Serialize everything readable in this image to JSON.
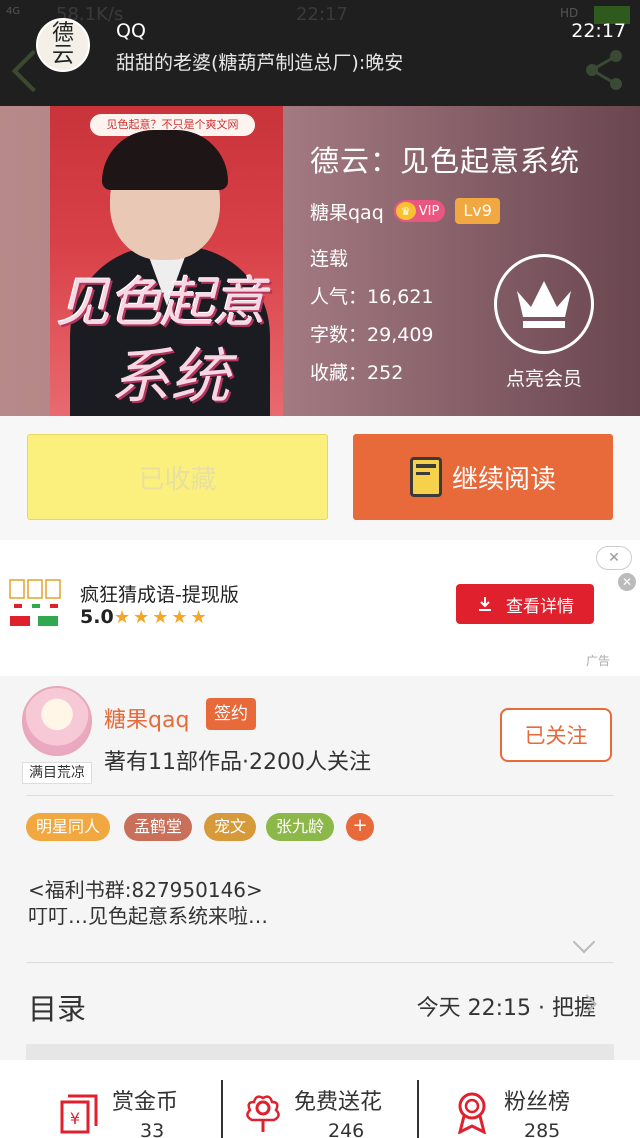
{
  "status_bar": {
    "network": "4G",
    "speed": "58.1K/s",
    "time": "22:17",
    "battery_label": "HD"
  },
  "notification": {
    "avatar_text": "德云",
    "app": "QQ",
    "message": "甜甜的老婆(糖葫芦制造总厂):晚安",
    "time": "22:17"
  },
  "book": {
    "cover_banner": "见色起意？不只是个爽文网",
    "cover_title_line1": "见色起意",
    "cover_title_line2": "系统",
    "title": "德云：见色起意系统",
    "author": "糖果qaq",
    "vip": "VIP",
    "level": "Lv9",
    "status": "连载",
    "popularity_label": "人气：",
    "popularity": "16,621",
    "words_label": "字数：",
    "words": "29,409",
    "favorites_label": "收藏：",
    "favorites": "252",
    "member_label": "点亮会员"
  },
  "actions": {
    "favorited": "已收藏",
    "continue": "继续阅读"
  },
  "ad": {
    "title": "疯狂猜成语-提现版",
    "rating": "5.0",
    "stars": "★★★★★",
    "button": "查看详情",
    "close": "✕",
    "tag": "广告"
  },
  "author": {
    "avatar_tag": "满目荒凉",
    "name": "糖果qaq",
    "badge": "签约",
    "info": "著有11部作品·2200人关注",
    "follow": "已关注",
    "tags": [
      "明星同人",
      "孟鹤堂",
      "宠文",
      "张九龄"
    ],
    "tag_colors": [
      "#f2a840",
      "#c8705a",
      "#d79a3a",
      "#8cb84a"
    ],
    "add_tag": "+"
  },
  "description": {
    "line1": "<福利书群:827950146>",
    "line2": "叮叮…见色起意系统来啦…"
  },
  "toc": {
    "label": "目录",
    "latest": "今天 22:15 · 把握"
  },
  "bottom": {
    "reward_label": "赏金币",
    "reward_count": "33",
    "flower_label": "免费送花",
    "flower_count": "246",
    "fans_label": "粉丝榜",
    "fans_count": "285"
  }
}
